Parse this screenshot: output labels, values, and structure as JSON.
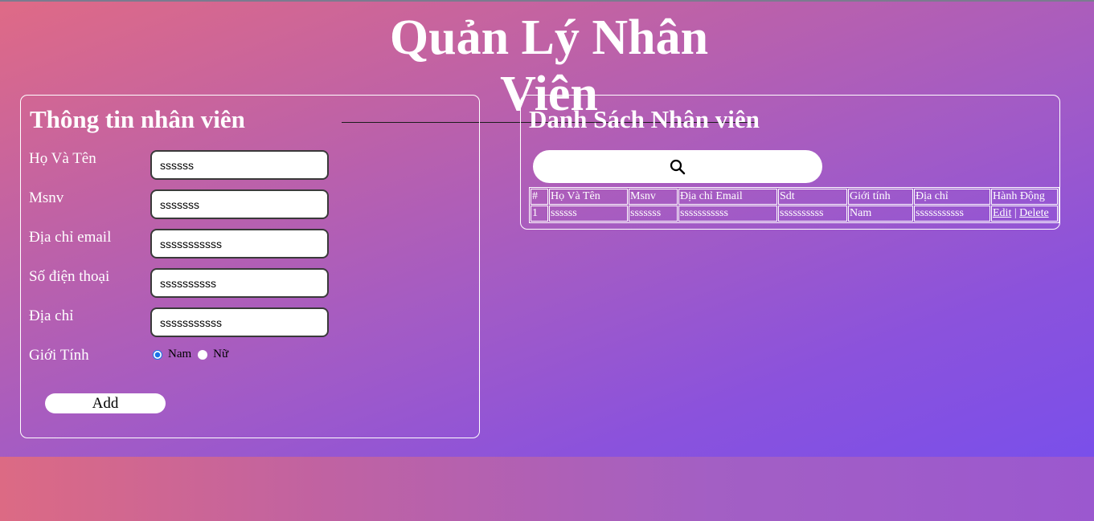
{
  "page": {
    "title": "Quản Lý Nhân Viên"
  },
  "form": {
    "title": "Thông tin nhân viên",
    "fields": [
      {
        "label": "Họ Và Tên",
        "value": "ssssss"
      },
      {
        "label": "Msnv",
        "value": "sssssss"
      },
      {
        "label": "Địa chỉ email",
        "value": "sssssssssss"
      },
      {
        "label": "Số điện thoại",
        "value": "ssssssssss"
      },
      {
        "label": "Địa chỉ",
        "value": "sssssssssss"
      }
    ],
    "gender": {
      "label": "Giới Tính",
      "options": [
        "Nam",
        "Nữ"
      ],
      "selected": "Nam"
    },
    "add_label": "Add"
  },
  "list": {
    "title": "Danh Sách Nhân viên",
    "search": {
      "icon": "search-icon",
      "value": ""
    },
    "table": {
      "headers": [
        "#",
        "Họ Và Tên",
        "Msnv",
        "Địa chỉ Email",
        "Sdt",
        "Giới tính",
        "Địa chỉ",
        "Hành Động"
      ],
      "rows": [
        {
          "no": "1",
          "name": "ssssss",
          "msnv": "sssssss",
          "email": "sssssssssss",
          "sdt": "ssssssssss",
          "gender": "Nam",
          "address": "sssssssssss",
          "edit": "Edit",
          "separator": "|",
          "delete": "Delete"
        }
      ]
    }
  },
  "colors": {
    "gradient_start": "#df6a86",
    "gradient_end": "#7a4fea",
    "radio_accent": "#1a73e8"
  }
}
